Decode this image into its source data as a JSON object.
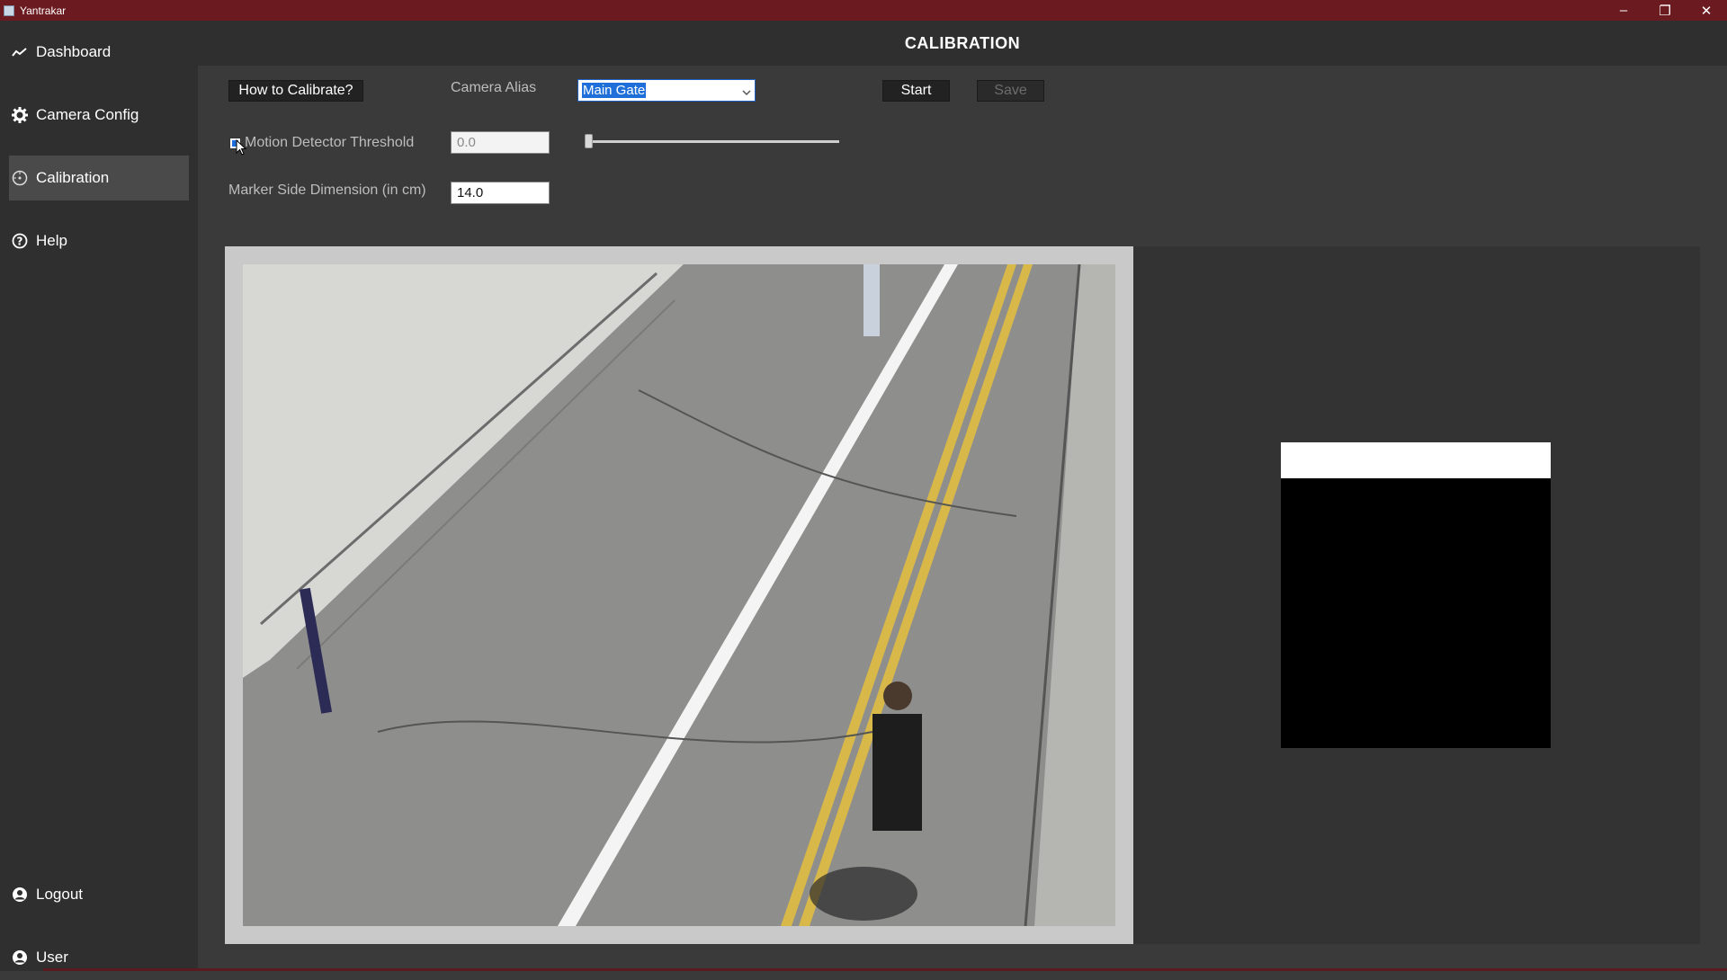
{
  "window": {
    "title": "Yantrakar",
    "controls": {
      "minimize": "–",
      "restore": "❐",
      "close": "✕"
    }
  },
  "sidebar": {
    "items": [
      {
        "label": "Dashboard",
        "icon": "dashboard-icon"
      },
      {
        "label": "Camera Config",
        "icon": "gear-icon"
      },
      {
        "label": "Calibration",
        "icon": "target-icon",
        "active": true
      },
      {
        "label": "Help",
        "icon": "help-circle-icon"
      },
      {
        "label": "Logout",
        "icon": "user-circle-icon"
      },
      {
        "label": "User",
        "icon": "user-circle-icon"
      }
    ]
  },
  "header": {
    "title": "CALIBRATION"
  },
  "controls": {
    "how_to_label": "How to Calibrate?",
    "camera_alias_label": "Camera Alias",
    "camera_alias_value": "Main Gate",
    "start_label": "Start",
    "save_label": "Save",
    "motion_threshold_label": "Motion Detector Threshold",
    "motion_threshold_value": "0.0",
    "motion_threshold_checked": true,
    "slider_value": 0.0,
    "marker_label": "Marker Side Dimension (in cm)",
    "marker_value": "14.0"
  },
  "colors": {
    "titlebar": "#6b1a20",
    "sidebar": "#2f2f2f",
    "background": "#3a3a3a",
    "selection": "#1e6fd9"
  }
}
